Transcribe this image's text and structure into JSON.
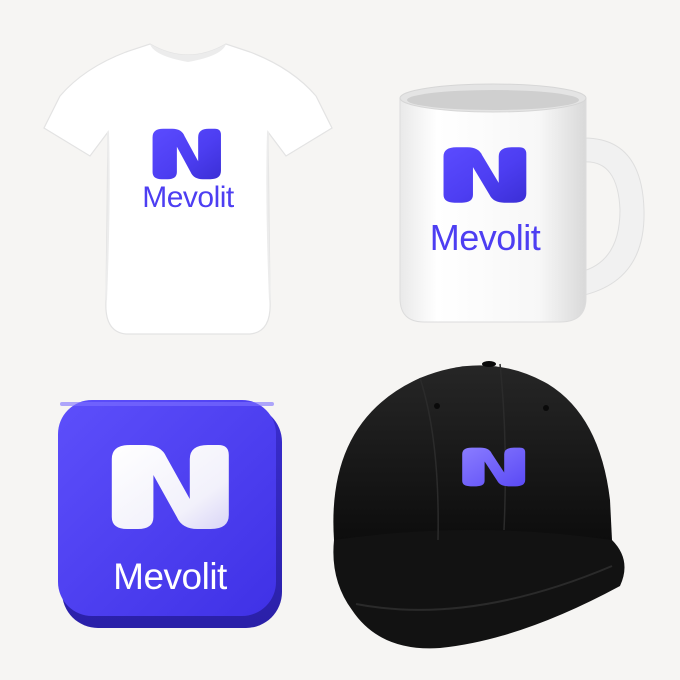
{
  "brand": {
    "name": "Mevolit",
    "colors": {
      "primary": "#4d3ef2",
      "primary_light": "#7a6bff",
      "on_primary": "#ffffff",
      "cap": "#161616",
      "background": "#f6f5f3"
    }
  },
  "items": [
    {
      "product": "t-shirt",
      "icon": "mevolit-n-logo-icon",
      "label": "Mevolit"
    },
    {
      "product": "mug",
      "icon": "mevolit-n-logo-icon",
      "label": "Mevolit"
    },
    {
      "product": "app-icon",
      "icon": "mevolit-n-logo-icon",
      "label": "Mevolit"
    },
    {
      "product": "cap",
      "icon": "mevolit-n-logo-icon"
    }
  ]
}
